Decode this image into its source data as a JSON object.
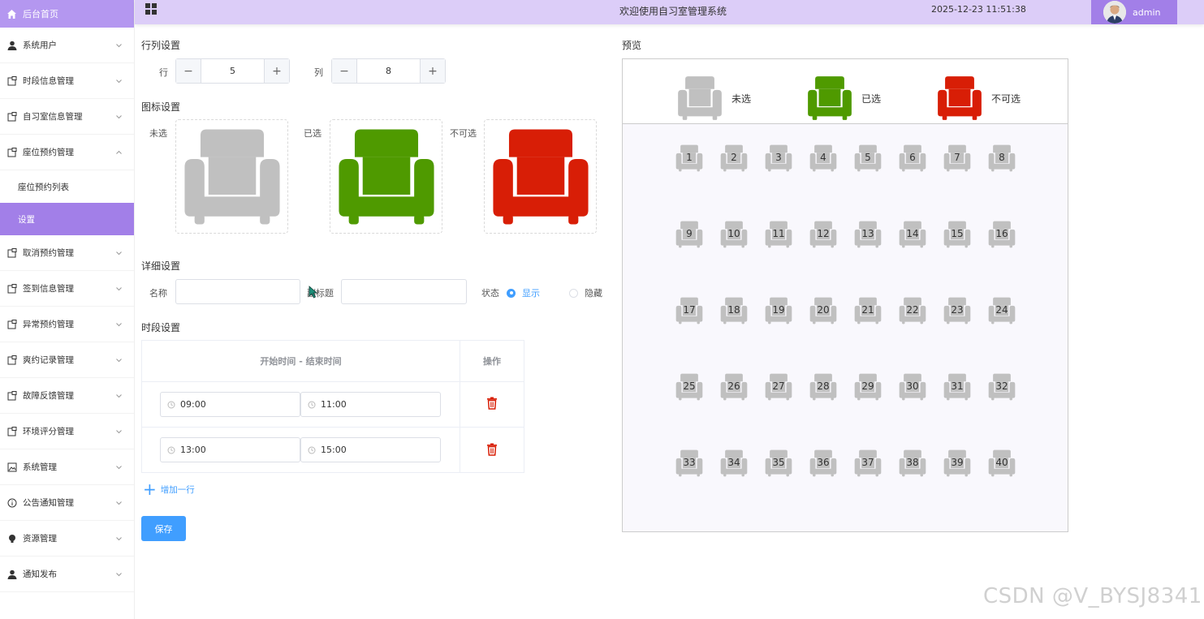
{
  "sidebar": {
    "home": "后台首页",
    "items": [
      {
        "label": "系统用户",
        "icon": "user-icon"
      },
      {
        "label": "时段信息管理",
        "icon": "doc-icon"
      },
      {
        "label": "自习室信息管理",
        "icon": "doc-icon"
      },
      {
        "label": "座位预约管理",
        "icon": "doc-icon"
      }
    ],
    "subitems": [
      "座位预约列表",
      "设置"
    ],
    "items2": [
      {
        "label": "取消预约管理",
        "icon": "doc-icon"
      },
      {
        "label": "签到信息管理",
        "icon": "doc-icon"
      },
      {
        "label": "异常预约管理",
        "icon": "doc-icon"
      },
      {
        "label": "爽约记录管理",
        "icon": "doc-icon"
      },
      {
        "label": "故障反馈管理",
        "icon": "doc-icon"
      },
      {
        "label": "环境评分管理",
        "icon": "doc-icon"
      },
      {
        "label": "系统管理",
        "icon": "image-icon"
      },
      {
        "label": "公告通知管理",
        "icon": "info-icon"
      },
      {
        "label": "资源管理",
        "icon": "bulb-icon"
      },
      {
        "label": "通知发布",
        "icon": "user-icon"
      }
    ]
  },
  "topbar": {
    "title": "欢迎使用自习室管理系统",
    "time": "2025-12-23 11:51:38",
    "user": "admin"
  },
  "rowcol": {
    "title": "行列设置",
    "row_label": "行",
    "row_value": "5",
    "col_label": "列",
    "col_value": "8",
    "minus": "−",
    "plus": "+"
  },
  "icons": {
    "title": "图标设置",
    "unselected": "未选",
    "selected": "已选",
    "unavailable": "不可选",
    "colors": {
      "unselected": "#c0c0c0",
      "selected": "#4f9a00",
      "unavailable": "#d81e06"
    }
  },
  "detail": {
    "title": "详细设置",
    "name_label": "名称",
    "subtitle_label": "副标题",
    "status_label": "状态",
    "show": "显示",
    "hide": "隐藏"
  },
  "timeslots": {
    "title": "时段设置",
    "col_time": "开始时间 - 结束时间",
    "col_op": "操作",
    "rows": [
      {
        "start": "09:00",
        "end": "11:00"
      },
      {
        "start": "13:00",
        "end": "15:00"
      }
    ],
    "add_row": "增加一行",
    "save": "保存"
  },
  "preview": {
    "title": "预览",
    "legend": [
      "未选",
      "已选",
      "不可选"
    ],
    "rows": 5,
    "cols": 8
  },
  "watermark": "CSDN @V_BYSJ8341"
}
